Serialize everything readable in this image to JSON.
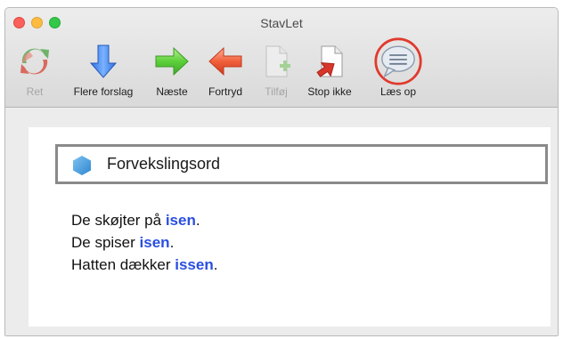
{
  "window": {
    "title": "StavLet"
  },
  "toolbar": {
    "items": [
      {
        "label": "Ret",
        "icon": "recycle-icon",
        "disabled": true
      },
      {
        "label": "Flere forslag",
        "icon": "down-arrow-icon",
        "disabled": false
      },
      {
        "label": "Næste",
        "icon": "right-arrow-icon",
        "disabled": false
      },
      {
        "label": "Fortryd",
        "icon": "left-arrow-icon",
        "disabled": false
      },
      {
        "label": "Tilføj",
        "icon": "add-document-icon",
        "disabled": true
      },
      {
        "label": "Stop ikke",
        "icon": "stop-document-icon",
        "disabled": false
      },
      {
        "label": "Læs op",
        "icon": "speech-bubble-icon",
        "disabled": false,
        "highlighted": true
      }
    ]
  },
  "main": {
    "heading": "Forvekslingsord",
    "sentences": [
      {
        "prefix": "De skøjter på ",
        "word": "isen",
        "suffix": "."
      },
      {
        "prefix": "De spiser ",
        "word": "isen",
        "suffix": "."
      },
      {
        "prefix": "Hatten dækker ",
        "word": "issen",
        "suffix": "."
      }
    ]
  },
  "colors": {
    "highlight_word": "#2a4fe0",
    "highlight_ring": "#e03a2e"
  }
}
